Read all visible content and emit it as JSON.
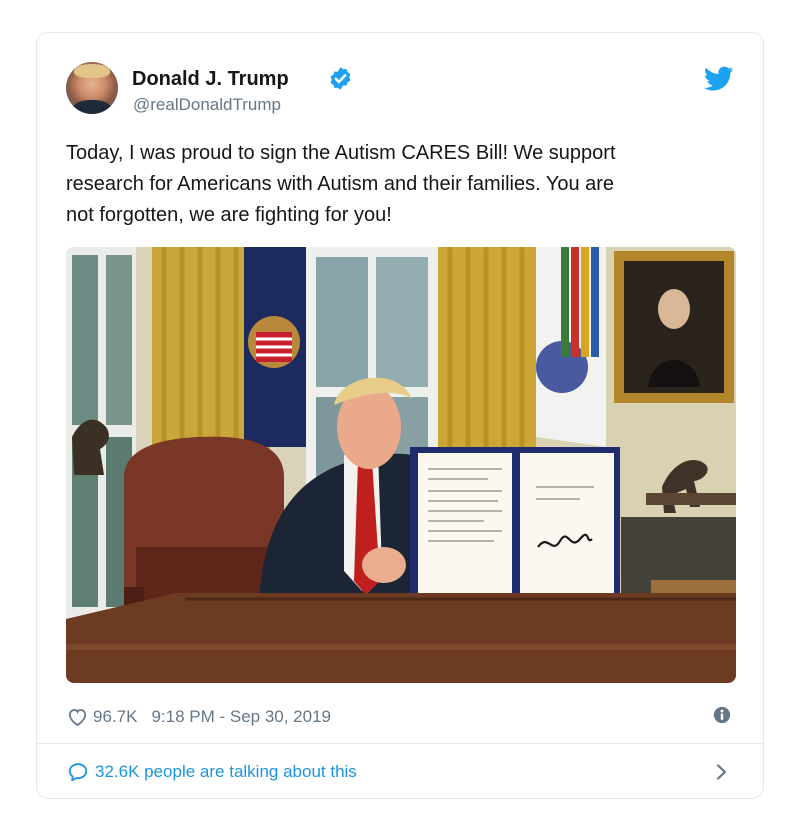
{
  "tweet": {
    "author_name": "Donald J. Trump",
    "handle": "@realDonaldTrump",
    "text": "Today, I was proud to sign the Autism CARES Bill! We support\nresearch for Americans with Autism and their families. You are\nnot forgotten, we are fighting for you!",
    "likes": "96.7K",
    "timestamp": "9:18 PM - Sep 30, 2019",
    "conversation_link": "32.6K people are talking about this"
  },
  "icons": {
    "verified": "verified-badge-icon",
    "logo": "twitter-bird-icon",
    "like": "heart-icon",
    "info": "info-icon",
    "reply": "speech-bubble-icon",
    "chevron": "chevron-right-icon"
  },
  "colors": {
    "brand_blue": "#1da1f2",
    "link_blue": "#1b95e0",
    "text": "#14171a",
    "secondary_text": "#657786",
    "border": "#e1e8ed"
  }
}
